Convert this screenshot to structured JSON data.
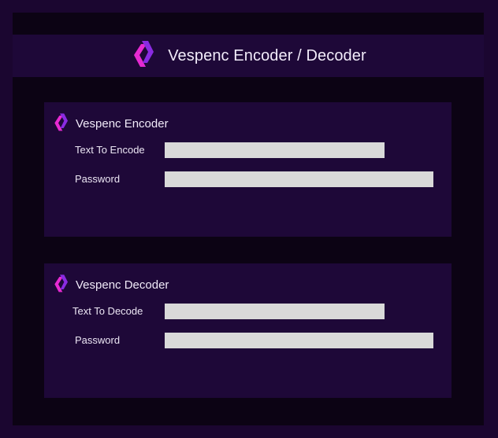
{
  "header": {
    "title": "Vespenc Encoder / Decoder",
    "logo_icon": "vespenc-logo-icon"
  },
  "encoder": {
    "title": "Vespenc Encoder",
    "text_label": "Text To Encode",
    "text_value": "",
    "password_label": "Password",
    "password_value": ""
  },
  "decoder": {
    "title": "Vespenc Decoder",
    "text_label": "Text To Decode",
    "text_value": "",
    "password_label": "Password",
    "password_value": ""
  },
  "colors": {
    "background": "#1b0630",
    "frame_dark": "#0c0314",
    "panel": "#1e0838",
    "input": "#d9d9d9",
    "logo_magenta": "#e62ad2",
    "logo_violet": "#8a2be2"
  }
}
